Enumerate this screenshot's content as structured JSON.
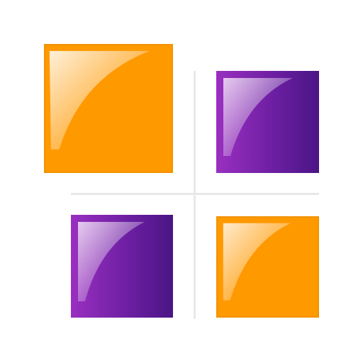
{
  "icon": {
    "name": "four-tile-grid-icon",
    "colors": {
      "background": "#ffffff",
      "orange": "#ff9900",
      "orange_border": "#f08c00",
      "purple_light": "#9a2fc0",
      "purple_dark": "#4a1585",
      "divider": "#e8e8e8"
    },
    "tiles": [
      {
        "id": "top-left",
        "color": "orange"
      },
      {
        "id": "top-right",
        "color": "purple"
      },
      {
        "id": "bottom-left",
        "color": "purple"
      },
      {
        "id": "bottom-right",
        "color": "orange"
      }
    ]
  }
}
